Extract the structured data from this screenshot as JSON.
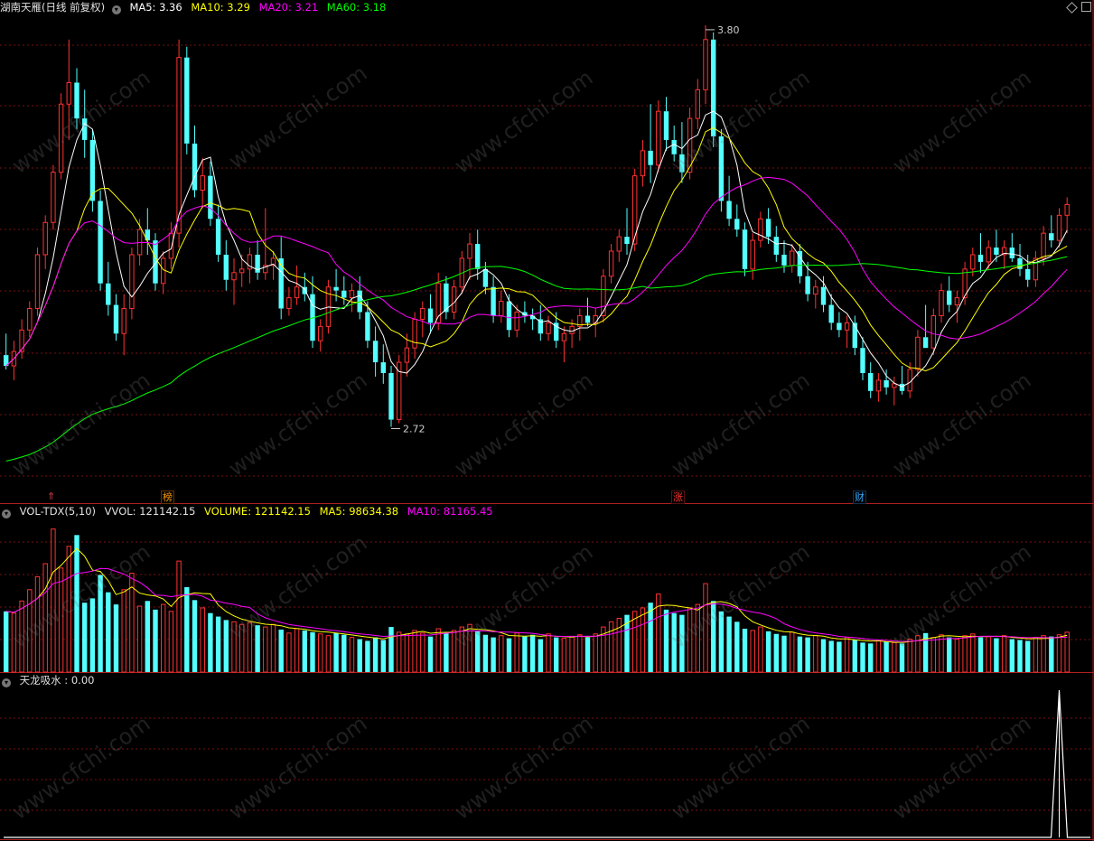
{
  "header": {
    "stock_label": "湖南天雁(日线 前复权)",
    "ma5": "MA5: 3.36",
    "ma10": "MA10: 3.29",
    "ma20": "MA20: 3.21",
    "ma60": "MA60: 3.18"
  },
  "volume_header": {
    "indicator": "VOL-TDX(5,10)",
    "vvol": "VVOL: 121142.15",
    "volume": "VOLUME: 121142.15",
    "ma5": "MA5: 98634.38",
    "ma10": "MA10: 81165.45"
  },
  "indicator_header": {
    "label": "天龙吸水 : 0.00"
  },
  "markers": [
    {
      "text": "⇑",
      "color": "#e04040"
    },
    {
      "text": "榜",
      "color": "#ff9900"
    },
    {
      "text": "涨",
      "color": "#ff3333"
    },
    {
      "text": "财",
      "color": "#33aaff"
    }
  ],
  "watermark": "www.cfchi.com",
  "colors": {
    "up": "#ff3232",
    "down": "#54ffff",
    "ma5": "#ffffff",
    "ma10": "#ffff00",
    "ma20": "#ff00ff",
    "ma60": "#00ff00",
    "grid": "#7a1010"
  },
  "chart_data": [
    {
      "type": "candlestick",
      "title": "湖南天雁(日线 前复权)",
      "annotations": [
        {
          "label": "3.80",
          "value": 3.8,
          "kind": "high"
        },
        {
          "label": "2.72",
          "value": 2.72,
          "kind": "low"
        }
      ],
      "ylim": [
        2.55,
        3.87
      ],
      "ohlc": [
        [
          2.92,
          2.98,
          2.88,
          2.89
        ],
        [
          2.89,
          2.96,
          2.85,
          2.93
        ],
        [
          2.93,
          3.02,
          2.91,
          2.99
        ],
        [
          2.99,
          3.07,
          2.97,
          3.05
        ],
        [
          3.05,
          3.22,
          3.03,
          3.2
        ],
        [
          3.2,
          3.31,
          3.16,
          3.29
        ],
        [
          3.29,
          3.45,
          3.27,
          3.43
        ],
        [
          3.43,
          3.65,
          3.41,
          3.62
        ],
        [
          3.62,
          3.8,
          3.52,
          3.68
        ],
        [
          3.68,
          3.72,
          3.55,
          3.58
        ],
        [
          3.58,
          3.66,
          3.47,
          3.52
        ],
        [
          3.52,
          3.55,
          3.32,
          3.35
        ],
        [
          3.35,
          3.38,
          3.1,
          3.12
        ],
        [
          3.12,
          3.18,
          3.03,
          3.06
        ],
        [
          3.06,
          3.09,
          2.96,
          2.98
        ],
        [
          2.98,
          3.09,
          2.92,
          3.05
        ],
        [
          3.05,
          3.22,
          3.02,
          3.2
        ],
        [
          3.2,
          3.3,
          3.17,
          3.27
        ],
        [
          3.27,
          3.33,
          3.2,
          3.24
        ],
        [
          3.24,
          3.26,
          3.1,
          3.12
        ],
        [
          3.12,
          3.21,
          3.09,
          3.19
        ],
        [
          3.19,
          3.29,
          3.16,
          3.26
        ],
        [
          3.26,
          3.8,
          3.22,
          3.75
        ],
        [
          3.75,
          3.78,
          3.48,
          3.51
        ],
        [
          3.51,
          3.56,
          3.36,
          3.38
        ],
        [
          3.38,
          3.47,
          3.33,
          3.42
        ],
        [
          3.42,
          3.46,
          3.28,
          3.3
        ],
        [
          3.3,
          3.34,
          3.18,
          3.2
        ],
        [
          3.2,
          3.24,
          3.1,
          3.13
        ],
        [
          3.13,
          3.19,
          3.06,
          3.15
        ],
        [
          3.15,
          3.2,
          3.11,
          3.16
        ],
        [
          3.16,
          3.22,
          3.12,
          3.2
        ],
        [
          3.2,
          3.24,
          3.13,
          3.15
        ],
        [
          3.15,
          3.33,
          3.13,
          3.17
        ],
        [
          3.17,
          3.21,
          3.13,
          3.19
        ],
        [
          3.19,
          3.25,
          3.02,
          3.05
        ],
        [
          3.05,
          3.11,
          3.03,
          3.08
        ],
        [
          3.08,
          3.17,
          3.06,
          3.11
        ],
        [
          3.11,
          3.15,
          3.07,
          3.09
        ],
        [
          3.09,
          3.14,
          2.94,
          2.96
        ],
        [
          2.96,
          3.02,
          2.93,
          3.0
        ],
        [
          3.0,
          3.13,
          2.98,
          3.11
        ],
        [
          3.11,
          3.16,
          3.07,
          3.1
        ],
        [
          3.1,
          3.14,
          3.06,
          3.08
        ],
        [
          3.08,
          3.12,
          3.04,
          3.1
        ],
        [
          3.1,
          3.14,
          3.02,
          3.04
        ],
        [
          3.04,
          3.07,
          2.94,
          2.96
        ],
        [
          2.96,
          3.0,
          2.86,
          2.9
        ],
        [
          2.9,
          2.95,
          2.84,
          2.87
        ],
        [
          2.87,
          2.89,
          2.72,
          2.74
        ],
        [
          2.74,
          2.92,
          2.73,
          2.9
        ],
        [
          2.9,
          2.98,
          2.86,
          2.94
        ],
        [
          2.94,
          3.04,
          2.91,
          3.02
        ],
        [
          3.02,
          3.07,
          2.97,
          3.05
        ],
        [
          3.05,
          3.09,
          2.98,
          3.01
        ],
        [
          3.01,
          3.15,
          2.99,
          3.12
        ],
        [
          3.12,
          3.14,
          3.02,
          3.04
        ],
        [
          3.04,
          3.13,
          3.02,
          3.11
        ],
        [
          3.11,
          3.21,
          3.09,
          3.19
        ],
        [
          3.19,
          3.26,
          3.13,
          3.23
        ],
        [
          3.23,
          3.27,
          3.13,
          3.16
        ],
        [
          3.16,
          3.18,
          3.09,
          3.11
        ],
        [
          3.11,
          3.14,
          3.01,
          3.03
        ],
        [
          3.03,
          3.1,
          3.01,
          3.07
        ],
        [
          3.07,
          3.09,
          2.97,
          2.99
        ],
        [
          2.99,
          3.06,
          2.97,
          3.04
        ],
        [
          3.04,
          3.07,
          3.01,
          3.03
        ],
        [
          3.03,
          3.05,
          2.99,
          3.02
        ],
        [
          3.02,
          3.06,
          2.96,
          2.98
        ],
        [
          2.98,
          3.03,
          2.96,
          3.01
        ],
        [
          3.01,
          3.04,
          2.94,
          2.96
        ],
        [
          2.96,
          3.0,
          2.9,
          2.98
        ],
        [
          2.98,
          3.02,
          2.94,
          3.0
        ],
        [
          3.0,
          3.05,
          2.96,
          3.03
        ],
        [
          3.03,
          3.08,
          3.0,
          3.01
        ],
        [
          3.01,
          3.05,
          2.97,
          3.03
        ],
        [
          3.03,
          3.16,
          3.01,
          3.14
        ],
        [
          3.14,
          3.23,
          3.12,
          3.21
        ],
        [
          3.21,
          3.27,
          3.18,
          3.25
        ],
        [
          3.25,
          3.33,
          3.2,
          3.23
        ],
        [
          3.23,
          3.44,
          3.21,
          3.42
        ],
        [
          3.42,
          3.52,
          3.39,
          3.49
        ],
        [
          3.49,
          3.62,
          3.4,
          3.45
        ],
        [
          3.45,
          3.63,
          3.43,
          3.6
        ],
        [
          3.6,
          3.64,
          3.49,
          3.52
        ],
        [
          3.52,
          3.56,
          3.46,
          3.48
        ],
        [
          3.48,
          3.57,
          3.4,
          3.43
        ],
        [
          3.43,
          3.61,
          3.41,
          3.58
        ],
        [
          3.58,
          3.69,
          3.55,
          3.66
        ],
        [
          3.66,
          3.84,
          3.62,
          3.8
        ],
        [
          3.8,
          3.82,
          3.5,
          3.53
        ],
        [
          3.53,
          3.55,
          3.32,
          3.35
        ],
        [
          3.35,
          3.42,
          3.28,
          3.3
        ],
        [
          3.3,
          3.34,
          3.25,
          3.27
        ],
        [
          3.27,
          3.29,
          3.14,
          3.16
        ],
        [
          3.16,
          3.26,
          3.13,
          3.24
        ],
        [
          3.24,
          3.32,
          3.22,
          3.3
        ],
        [
          3.3,
          3.33,
          3.23,
          3.25
        ],
        [
          3.25,
          3.28,
          3.18,
          3.2
        ],
        [
          3.2,
          3.24,
          3.15,
          3.17
        ],
        [
          3.17,
          3.23,
          3.15,
          3.21
        ],
        [
          3.21,
          3.23,
          3.12,
          3.14
        ],
        [
          3.14,
          3.18,
          3.07,
          3.09
        ],
        [
          3.09,
          3.13,
          3.05,
          3.11
        ],
        [
          3.11,
          3.14,
          3.04,
          3.06
        ],
        [
          3.06,
          3.09,
          2.99,
          3.01
        ],
        [
          3.01,
          3.04,
          2.97,
          2.99
        ],
        [
          2.99,
          3.03,
          2.94,
          3.01
        ],
        [
          3.01,
          3.03,
          2.92,
          2.94
        ],
        [
          2.94,
          2.97,
          2.85,
          2.87
        ],
        [
          2.87,
          2.9,
          2.8,
          2.82
        ],
        [
          2.82,
          2.87,
          2.79,
          2.85
        ],
        [
          2.85,
          2.88,
          2.81,
          2.83
        ],
        [
          2.83,
          2.86,
          2.78,
          2.84
        ],
        [
          2.84,
          2.89,
          2.81,
          2.82
        ],
        [
          2.82,
          2.9,
          2.8,
          2.88
        ],
        [
          2.88,
          2.99,
          2.86,
          2.97
        ],
        [
          2.97,
          3.06,
          2.94,
          2.94
        ],
        [
          2.94,
          3.05,
          2.92,
          3.03
        ],
        [
          3.03,
          3.12,
          3.01,
          3.1
        ],
        [
          3.1,
          3.14,
          3.04,
          3.06
        ],
        [
          3.06,
          3.1,
          3.01,
          3.08
        ],
        [
          3.08,
          3.18,
          3.06,
          3.16
        ],
        [
          3.16,
          3.22,
          3.14,
          3.2
        ],
        [
          3.2,
          3.26,
          3.15,
          3.18
        ],
        [
          3.18,
          3.24,
          3.16,
          3.22
        ],
        [
          3.22,
          3.27,
          3.18,
          3.2
        ],
        [
          3.2,
          3.24,
          3.16,
          3.22
        ],
        [
          3.22,
          3.26,
          3.18,
          3.19
        ],
        [
          3.19,
          3.23,
          3.14,
          3.16
        ],
        [
          3.16,
          3.2,
          3.11,
          3.13
        ],
        [
          3.13,
          3.21,
          3.11,
          3.19
        ],
        [
          3.19,
          3.28,
          3.17,
          3.26
        ],
        [
          3.26,
          3.31,
          3.22,
          3.24
        ],
        [
          3.24,
          3.33,
          3.22,
          3.31
        ],
        [
          3.31,
          3.36,
          3.26,
          3.34
        ]
      ],
      "volume": [
        70,
        68,
        82,
        95,
        110,
        125,
        165,
        120,
        145,
        158,
        80,
        85,
        112,
        92,
        78,
        95,
        114,
        76,
        82,
        72,
        78,
        70,
        128,
        98,
        83,
        74,
        68,
        64,
        60,
        58,
        55,
        57,
        54,
        52,
        55,
        49,
        45,
        50,
        48,
        46,
        44,
        42,
        45,
        43,
        40,
        38,
        36,
        40,
        37,
        52,
        46,
        44,
        48,
        45,
        41,
        50,
        45,
        48,
        52,
        55,
        47,
        43,
        40,
        42,
        39,
        45,
        41,
        43,
        38,
        44,
        40,
        39,
        41,
        43,
        40,
        44,
        52,
        58,
        62,
        66,
        70,
        74,
        80,
        90,
        72,
        68,
        66,
        74,
        78,
        102,
        82,
        70,
        64,
        58,
        50,
        48,
        52,
        47,
        44,
        42,
        46,
        41,
        40,
        42,
        38,
        36,
        35,
        40,
        37,
        34,
        33,
        36,
        35,
        34,
        33,
        38,
        42,
        45,
        40,
        43,
        40,
        38,
        42,
        44,
        40,
        41,
        39,
        42,
        38,
        37,
        36,
        40,
        42,
        41,
        43,
        46
      ]
    },
    {
      "type": "line",
      "title": "天龙吸水",
      "value_label": "0.00",
      "spike_index": 134,
      "spike_value": 1.0
    }
  ]
}
